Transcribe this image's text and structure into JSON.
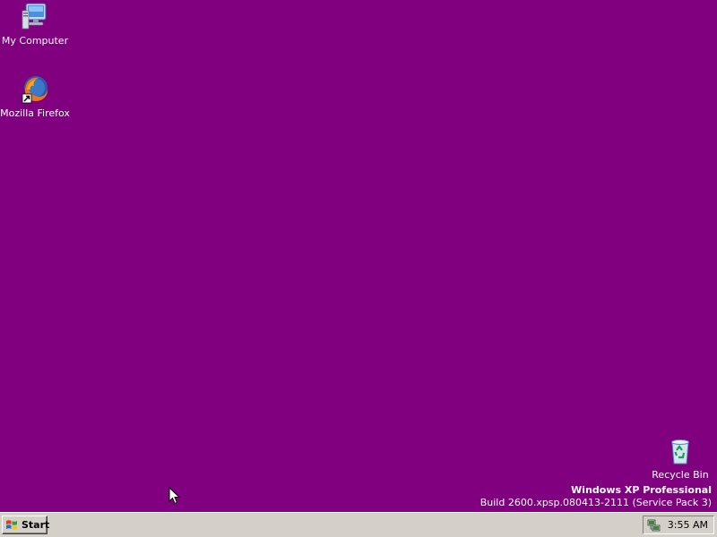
{
  "colors": {
    "desktop_background": "#800080",
    "taskbar_face": "#d4d0c8",
    "label_text": "#ffffff"
  },
  "desktop": {
    "icons": [
      {
        "label": "My Computer",
        "icon": "my-computer-icon"
      },
      {
        "label": "Mozilla Firefox",
        "icon": "firefox-shortcut-icon"
      },
      {
        "label": "Recycle Bin",
        "icon": "recycle-bin-icon"
      }
    ],
    "branding": {
      "title": "Windows XP Professional",
      "build": "Build 2600.xpsp.080413-2111 (Service Pack 3)"
    }
  },
  "taskbar": {
    "start_label": "Start",
    "tray": {
      "network_icon": "network-connection-icon",
      "clock": "3:55 AM"
    }
  }
}
